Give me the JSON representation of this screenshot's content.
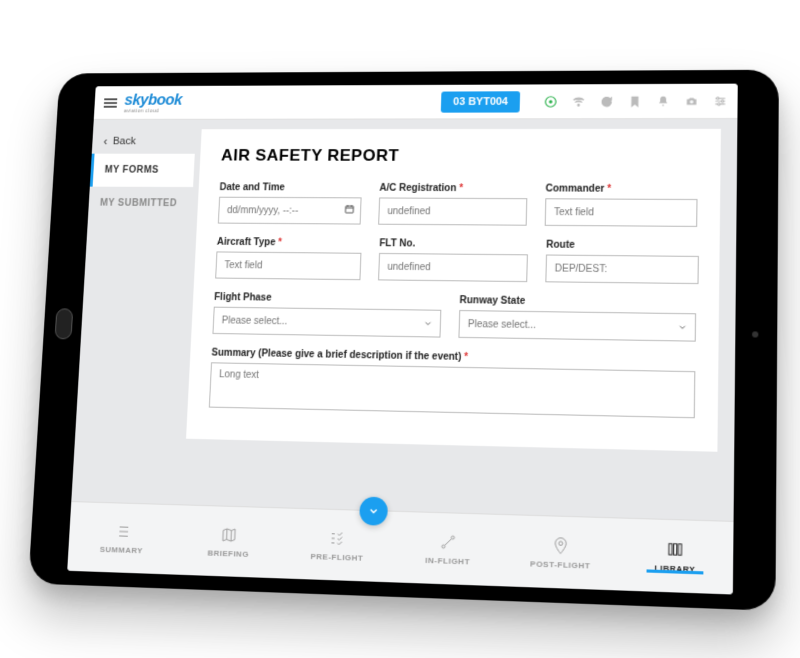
{
  "brand": {
    "name": "skybook",
    "sub": "aviation cloud"
  },
  "topbar": {
    "flight_badge": "03 BYT004"
  },
  "sidebar": {
    "back_label": "Back",
    "items": [
      {
        "label": "MY FORMS",
        "active": true
      },
      {
        "label": "MY SUBMITTED",
        "active": false
      }
    ]
  },
  "form": {
    "title": "AIR SAFETY REPORT",
    "fields": {
      "datetime": {
        "label": "Date and Time",
        "placeholder": "dd/mm/yyyy, --:--",
        "required": false
      },
      "ac_reg": {
        "label": "A/C Registration",
        "placeholder": "undefined",
        "required": true
      },
      "commander": {
        "label": "Commander",
        "placeholder": "Text field",
        "required": true
      },
      "aircraft_type": {
        "label": "Aircraft Type",
        "placeholder": "Text field",
        "required": true
      },
      "flt_no": {
        "label": "FLT No.",
        "placeholder": "undefined",
        "required": false
      },
      "route": {
        "label": "Route",
        "placeholder": "DEP/DEST:",
        "required": false
      },
      "flight_phase": {
        "label": "Flight Phase",
        "placeholder": "Please select...",
        "required": false
      },
      "runway_state": {
        "label": "Runway State",
        "placeholder": "Please select...",
        "required": false
      },
      "summary": {
        "label": "Summary (Please give a brief description if the event)",
        "placeholder": "Long text",
        "required": true
      }
    }
  },
  "tabs": [
    {
      "label": "SUMMARY"
    },
    {
      "label": "BRIEFING"
    },
    {
      "label": "PRE-FLIGHT"
    },
    {
      "label": "IN-FLIGHT"
    },
    {
      "label": "POST-FLIGHT"
    },
    {
      "label": "LIBRARY"
    }
  ],
  "active_tab": 5
}
